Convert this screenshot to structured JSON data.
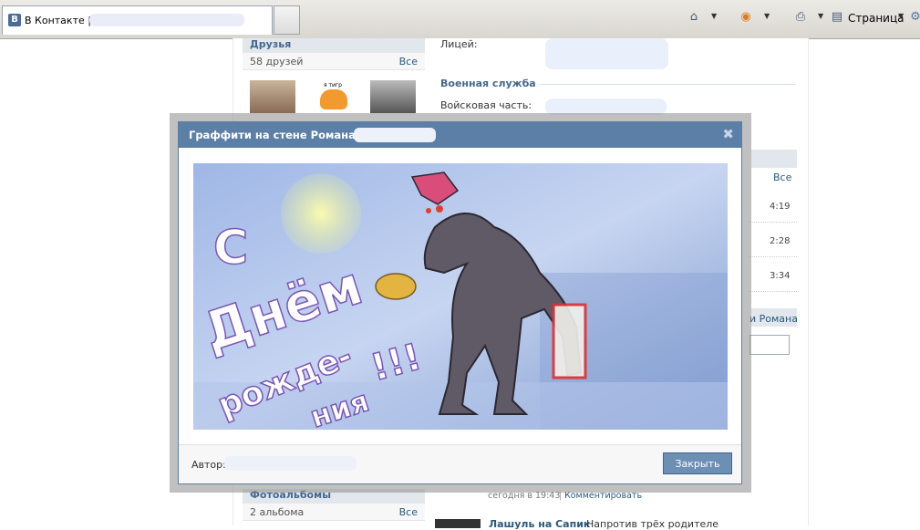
{
  "browser": {
    "tab_title": "В Контакте |",
    "favicon_letter": "B",
    "page_menu": "Страница"
  },
  "left": {
    "friends_title": "Друзья",
    "friends_count": "58 друзей",
    "friends_all": "Все",
    "tiger_caption": "я тигр",
    "albums_title": "Фотоальбомы",
    "albums_count": "2 альбома",
    "albums_all": "Все"
  },
  "right": {
    "lyceum_label": "Лицей:",
    "military_title": "Военная служба",
    "unit_label": "Войсковая часть:",
    "audio_all": "Все",
    "audio_times": [
      "4:19",
      "2:28",
      "3:34"
    ],
    "wall_owner": "и Романа",
    "post_time": "сегодня в 19:43",
    "comment_link": "Комментировать",
    "next_post_author": "Лашуль на Сапик",
    "next_post_text": "Напротив трёх родителе"
  },
  "dialog": {
    "title": "Граффити на стене Романа",
    "author_label": "Автор:",
    "close_button": "Закрыть",
    "graffiti_text": [
      "С",
      "Днём",
      "рожде-",
      "ния",
      "!!!"
    ]
  },
  "colors": {
    "vk_blue": "#5b7fa6",
    "link": "#2b587a"
  }
}
